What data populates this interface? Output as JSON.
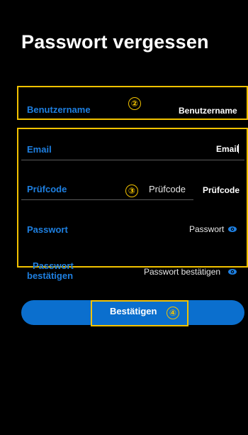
{
  "page": {
    "title": "Passwort vergessen"
  },
  "form": {
    "username": {
      "label": "Benutzername",
      "placeholder": "Benutzername"
    },
    "email": {
      "label": "Email",
      "value": "Email"
    },
    "code": {
      "label": "Prüfcode",
      "placeholder": "Prüfcode",
      "button_label": "Prüfcode"
    },
    "password": {
      "label": "Passwort",
      "placeholder": "Passwort"
    },
    "confirm_password": {
      "label_line1": "Passwort",
      "label_line2": "bestätigen",
      "placeholder": "Passwort bestätigen"
    }
  },
  "actions": {
    "confirm_label": "Bestätigen"
  },
  "annotations": {
    "marker_2": "②",
    "marker_3": "③",
    "marker_4": "④"
  },
  "colors": {
    "accent_blue": "#1e7fe0",
    "button_blue": "#0b6fce",
    "annotation_yellow": "#f2c200",
    "background": "#000000"
  },
  "icons": {
    "password_toggle": "eye-icon"
  }
}
